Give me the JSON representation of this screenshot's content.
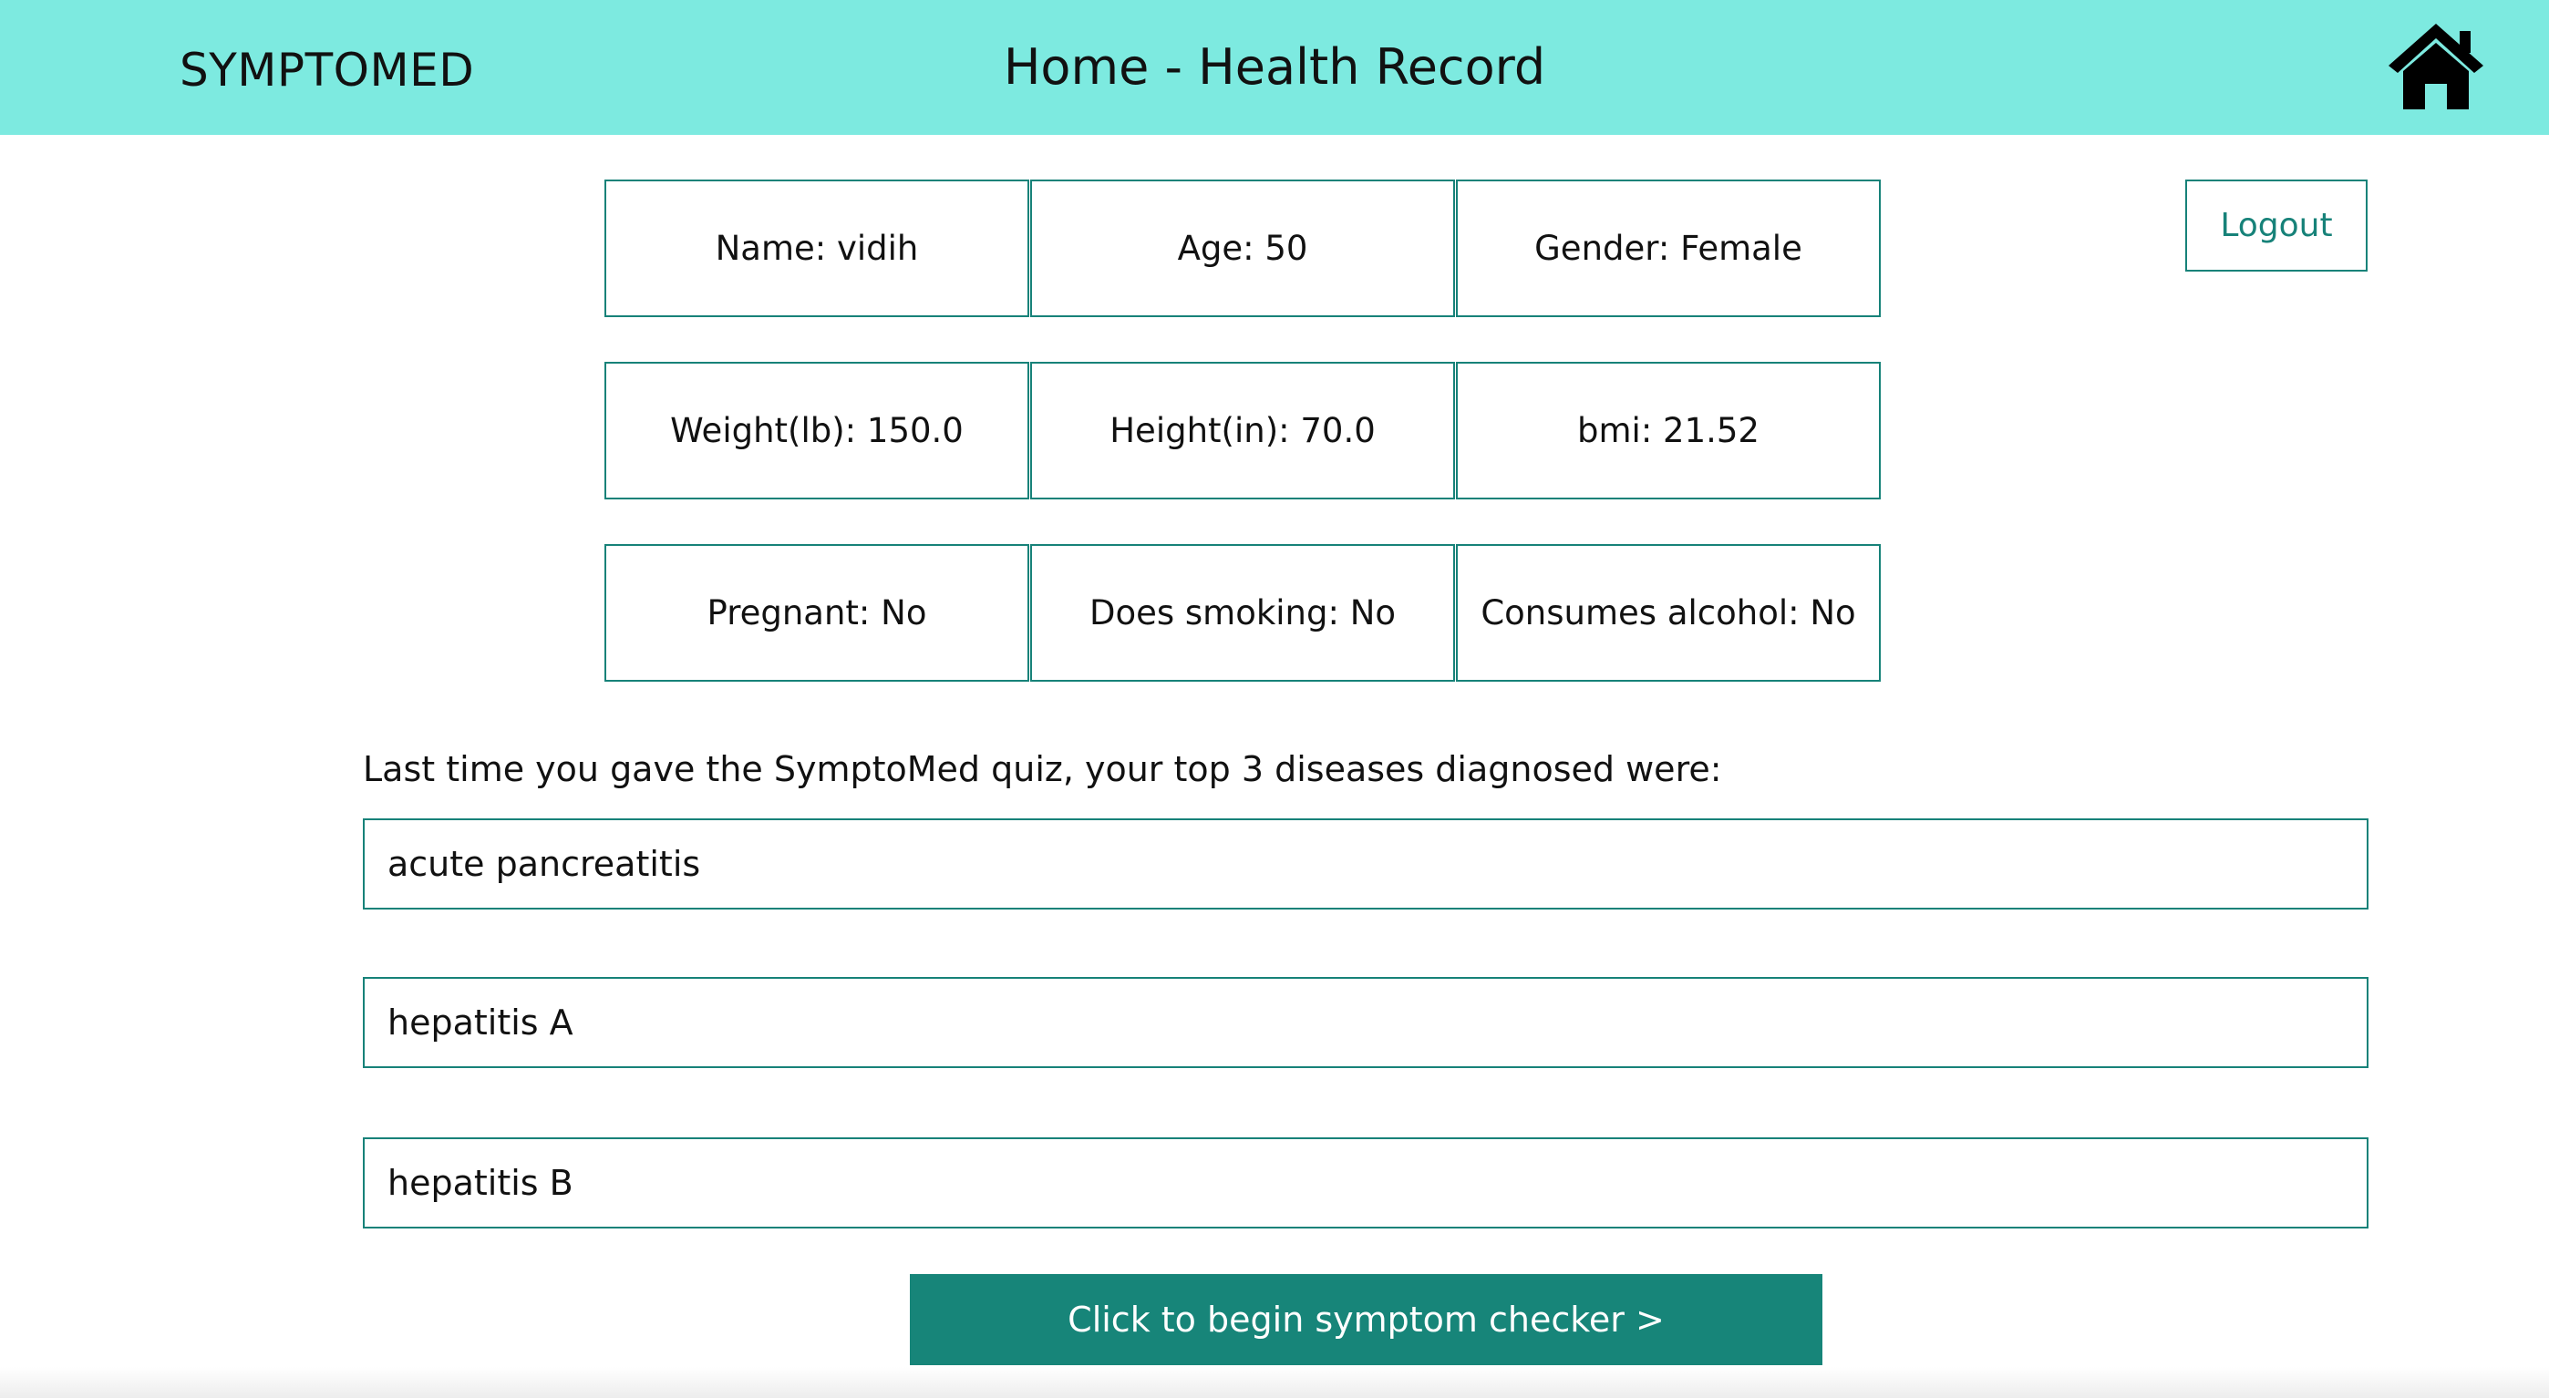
{
  "header": {
    "brand": "SYMPTOMED",
    "title": "Home - Health Record",
    "home_icon": "home-icon",
    "background_color": "#7deae0"
  },
  "logout_label": "Logout",
  "profile": {
    "rows": [
      [
        "Name: vidih",
        "Age: 50",
        "Gender: Female"
      ],
      [
        "Weight(lb): 150.0",
        "Height(in): 70.0",
        "bmi: 21.52"
      ],
      [
        "Pregnant: No",
        "Does smoking: No",
        "Consumes alcohol: No"
      ]
    ]
  },
  "diagnosis": {
    "intro": "Last time you gave the SymptoMed quiz, your top 3 diseases diagnosed were:",
    "diseases": [
      "acute pancreatitis",
      "hepatitis A",
      "hepatitis B"
    ]
  },
  "cta_label": "Click to begin symptom checker >",
  "colors": {
    "accent": "#178279",
    "button": "#178579"
  }
}
